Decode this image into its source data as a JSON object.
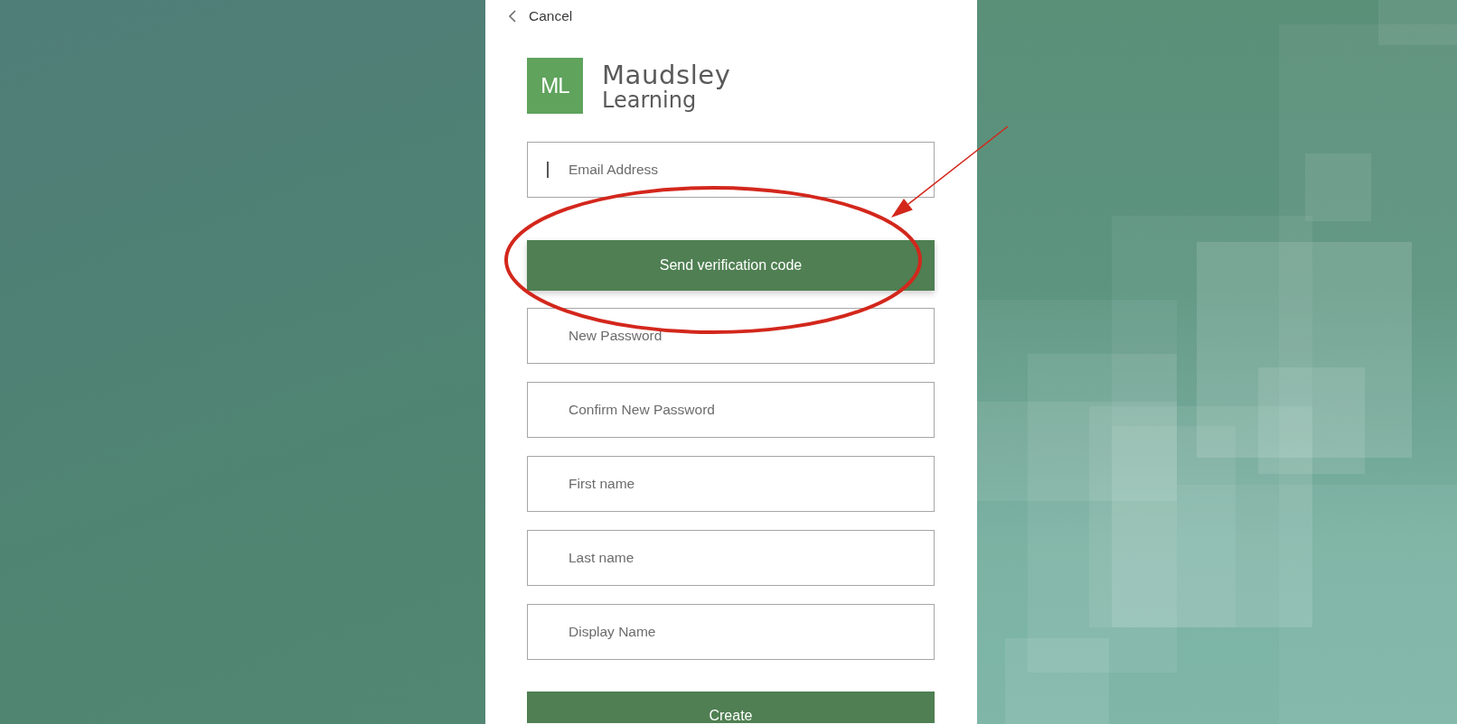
{
  "cancel_link": {
    "label": "Cancel"
  },
  "logo": {
    "monogram": "ML",
    "name_lines": [
      "Maudsley",
      "Learning"
    ]
  },
  "form": {
    "items": [
      {
        "kind": "field",
        "placeholder": "Email Address",
        "focused": true
      },
      {
        "kind": "button",
        "label": "Send verification code"
      },
      {
        "kind": "field",
        "placeholder": "New Password",
        "focused": false
      },
      {
        "kind": "field",
        "placeholder": "Confirm New Password",
        "focused": false
      },
      {
        "kind": "field",
        "placeholder": "First name",
        "focused": false
      },
      {
        "kind": "field",
        "placeholder": "Last name",
        "focused": false
      },
      {
        "kind": "field",
        "placeholder": "Display Name",
        "focused": false
      },
      {
        "kind": "button",
        "label": "Create"
      }
    ]
  },
  "annotations": [
    {
      "kind": "ellipse"
    },
    {
      "kind": "arrow"
    }
  ]
}
